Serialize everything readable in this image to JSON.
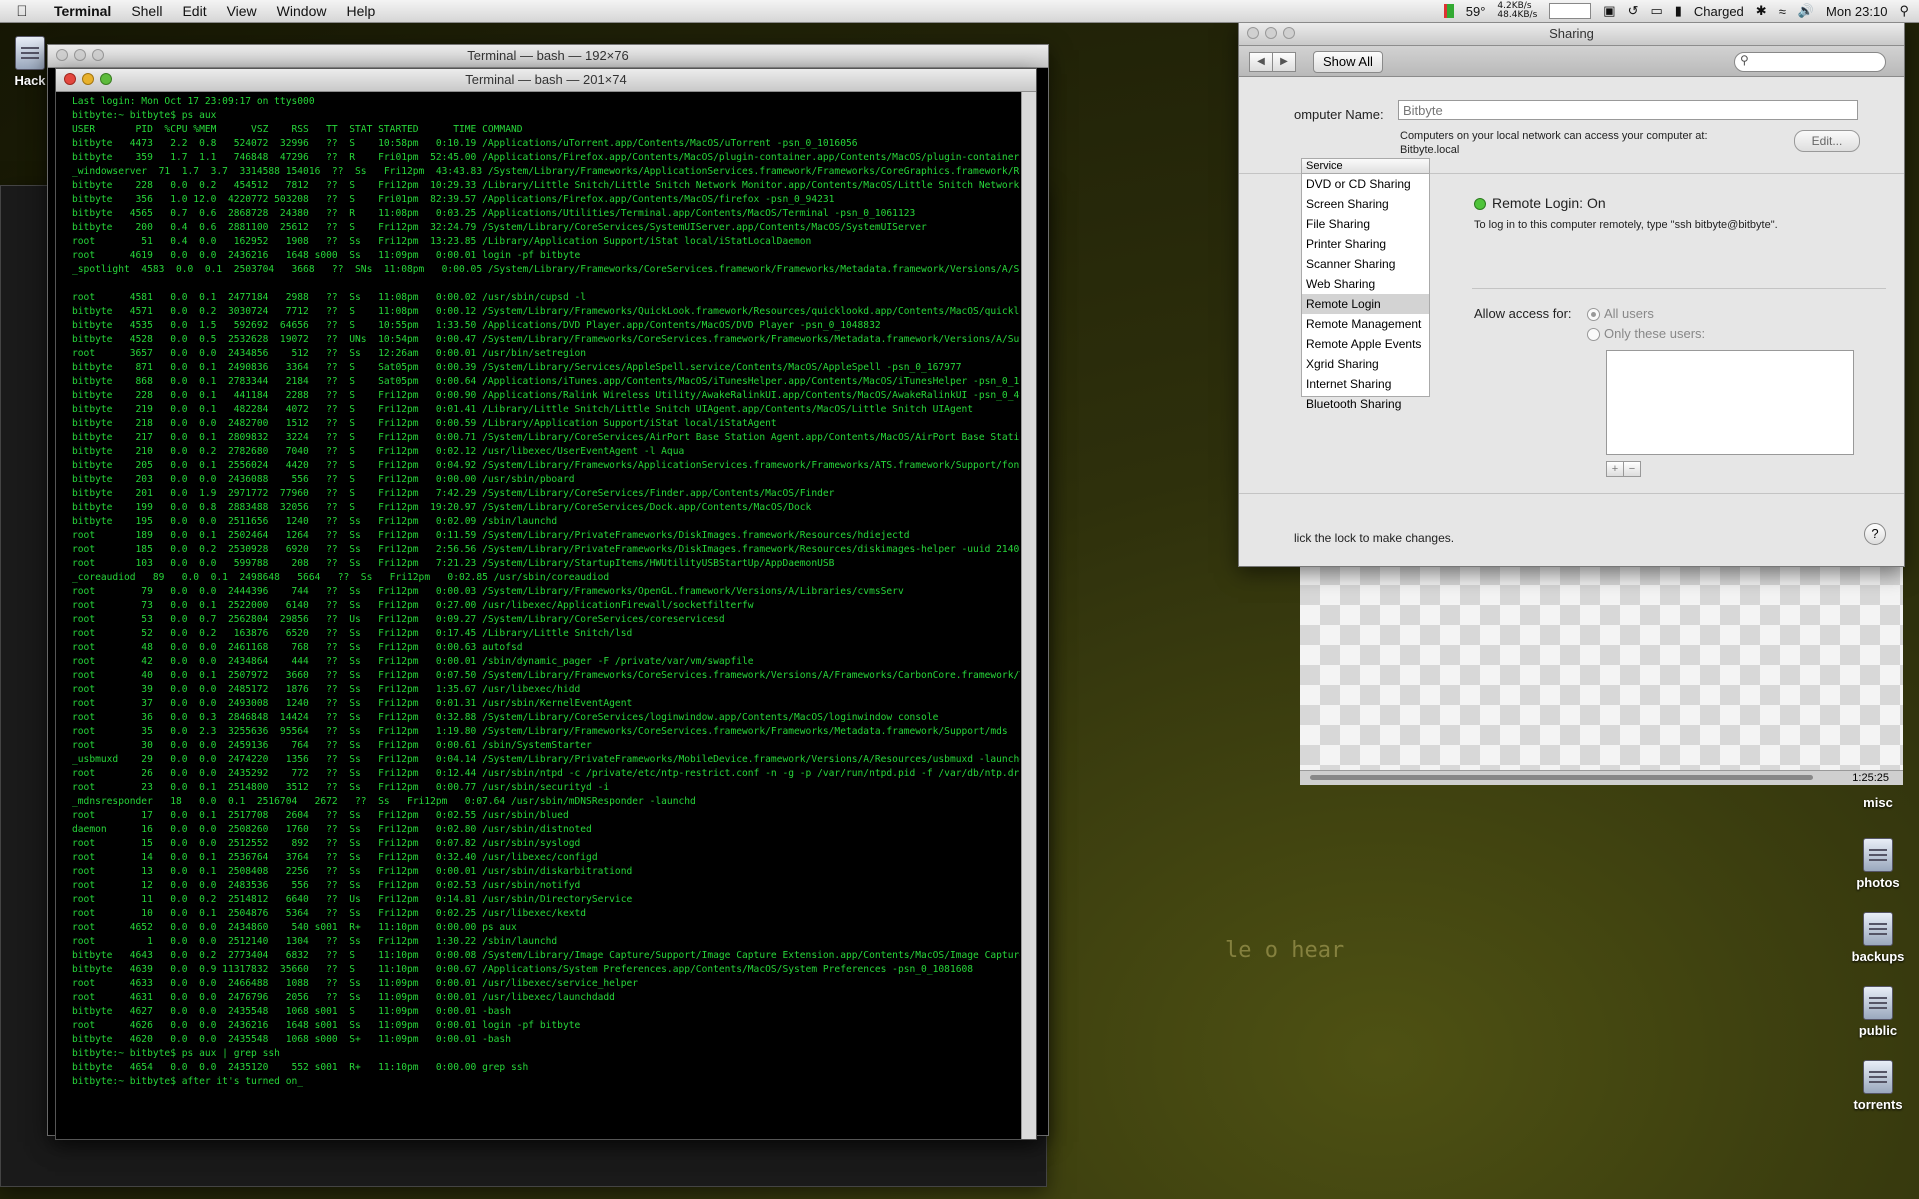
{
  "menubar": {
    "app_name": "Terminal",
    "menus": [
      "Shell",
      "Edit",
      "View",
      "Window",
      "Help"
    ],
    "status": {
      "temperature": "59°",
      "net_up": "4.2KB/s",
      "net_down": "48.4KB/s",
      "battery": "Charged",
      "clock": "Mon 23:10"
    }
  },
  "desktop": {
    "left_label": "Hack",
    "drives": [
      "misc",
      "photos",
      "backups",
      "public",
      "torrents"
    ],
    "wallpaper_text": "le  o hear"
  },
  "terminal_back": {
    "title": "Terminal — bash — 192×76"
  },
  "terminal_front": {
    "title": "Terminal — bash — 201×74",
    "lines": [
      "Last login: Mon Oct 17 23:09:17 on ttys000",
      "bitbyte:~ bitbyte$ ps aux",
      "USER       PID  %CPU %MEM      VSZ    RSS   TT  STAT STARTED      TIME COMMAND",
      "bitbyte   4473   2.2  0.8   524072  32996   ??  S    10:58pm   0:10.19 /Applications/uTorrent.app/Contents/MacOS/uTorrent -psn_0_1016056",
      "bitbyte    359   1.7  1.1   746848  47296   ??  R    Fri01pm  52:45.00 /Applications/Firefox.app/Contents/MacOS/plugin-container.app/Contents/MacOS/plugin-container /Library/Internet Plug-Ins/Flash Pl",
      "_windowserver  71  1.7  3.7  3314588 154016  ??  Ss   Fri12pm  43:43.83 /System/Library/Frameworks/ApplicationServices.framework/Frameworks/CoreGraphics.framework/Resources/WindowServer -daemon",
      "bitbyte    228   0.0  0.2   454512   7812   ??  S    Fri12pm  10:29.33 /Library/Little Snitch/Little Snitch Network Monitor.app/Contents/MacOS/Little Snitch Network Monitor",
      "bitbyte    356   1.0 12.0  4220772 503208   ??  S    Fri01pm  82:39.57 /Applications/Firefox.app/Contents/MacOS/firefox -psn_0_94231",
      "bitbyte   4565   0.7  0.6  2868728  24380   ??  R    11:08pm   0:03.25 /Applications/Utilities/Terminal.app/Contents/MacOS/Terminal -psn_0_1061123",
      "bitbyte    200   0.4  0.6  2881100  25612   ??  S    Fri12pm  32:24.79 /System/Library/CoreServices/SystemUIServer.app/Contents/MacOS/SystemUIServer",
      "root        51   0.4  0.0   162952   1908   ??  Ss   Fri12pm  13:23.85 /Library/Application Support/iStat local/iStatLocalDaemon",
      "root      4619   0.0  0.0  2436216   1648 s000  Ss   11:09pm   0:00.01 login -pf bitbyte",
      "_spotlight  4583  0.0  0.1  2503704   3668   ??  SNs  11:08pm   0:00.05 /System/Library/Frameworks/CoreServices.framework/Frameworks/Metadata.framework/Versions/A/Support/mdworker MDSImporterWorker co",
      "",
      "root      4581   0.0  0.1  2477184   2988   ??  Ss   11:08pm   0:00.02 /usr/sbin/cupsd -l",
      "bitbyte   4571   0.0  0.2  3030724   7712   ??  S    11:08pm   0:00.12 /System/Library/Frameworks/QuickLook.framework/Resources/quicklookd.app/Contents/MacOS/quicklookd",
      "bitbyte   4535   0.0  1.5   592692  64656   ??  S    10:55pm   1:33.50 /Applications/DVD Player.app/Contents/MacOS/DVD Player -psn_0_1048832",
      "bitbyte   4528   0.0  0.5  2532628  19072   ??  UNs  10:54pm   0:00.47 /System/Library/Frameworks/CoreServices.framework/Frameworks/Metadata.framework/Versions/A/Support/mdworker MDSImporterWorker com",
      "root      3657   0.0  0.0  2434856    512   ??  Ss   12:26am   0:00.01 /usr/bin/setregion",
      "bitbyte    871   0.0  0.1  2490836   3364   ??  S    Sat05pm   0:00.39 /System/Library/Services/AppleSpell.service/Contents/MacOS/AppleSpell -psn_0_167977",
      "bitbyte    868   0.0  0.1  2783344   2184   ??  S    Sat05pm   0:00.64 /Applications/iTunes.app/Contents/MacOS/iTunesHelper.app/Contents/MacOS/iTunesHelper -psn_0_163880",
      "bitbyte    228   0.0  0.1   441184   2288   ??  S    Fri12pm   0:00.90 /Applications/Ralink Wireless Utility/AwakeRalinkUI.app/Contents/MacOS/AwakeRalinkUI -psn_0_49164",
      "bitbyte    219   0.0  0.1   482284   4072   ??  S    Fri12pm   0:01.41 /Library/Little Snitch/Little Snitch UIAgent.app/Contents/MacOS/Little Snitch UIAgent",
      "bitbyte    218   0.0  0.0  2482700   1512   ??  S    Fri12pm   0:00.59 /Library/Application Support/iStat local/iStatAgent",
      "bitbyte    217   0.0  0.1  2809832   3224   ??  S    Fri12pm   0:00.71 /System/Library/CoreServices/AirPort Base Station Agent.app/Contents/MacOS/AirPort Base Station Agent -launchd -allowquit",
      "bitbyte    210   0.0  0.2  2782680   7040   ??  S    Fri12pm   0:02.12 /usr/libexec/UserEventAgent -l Aqua",
      "bitbyte    205   0.0  0.1  2556024   4420   ??  S    Fri12pm   0:04.92 /System/Library/Frameworks/ApplicationServices.framework/Frameworks/ATS.framework/Support/fontd",
      "bitbyte    203   0.0  0.0  2436088    556   ??  S    Fri12pm   0:00.00 /usr/sbin/pboard",
      "bitbyte    201   0.0  1.9  2971772  77960   ??  S    Fri12pm   7:42.29 /System/Library/CoreServices/Finder.app/Contents/MacOS/Finder",
      "bitbyte    199   0.0  0.8  2883488  32056   ??  S    Fri12pm  19:20.97 /System/Library/CoreServices/Dock.app/Contents/MacOS/Dock",
      "bitbyte    195   0.0  0.0  2511656   1240   ??  Ss   Fri12pm   0:02.09 /sbin/launchd",
      "root       189   0.0  0.1  2502464   1264   ??  Ss   Fri12pm   0:11.59 /System/Library/PrivateFrameworks/DiskImages.framework/Resources/hdiejectd",
      "root       185   0.0  0.2  2530928   6920   ??  Ss   Fri12pm   2:56.56 /System/Library/PrivateFrameworks/DiskImages.framework/Resources/diskimages-helper -uuid 2140818F-C632-4D85-A243-3D146F4D1E2F -po",
      "root       103   0.0  0.0   599788    208   ??  Ss   Fri12pm   7:21.23 /System/Library/StartupItems/HWUtilityUSBStartUp/AppDaemonUSB",
      "_coreaudiod   89   0.0  0.1  2498648   5664   ??  Ss   Fri12pm   0:02.85 /usr/sbin/coreaudiod",
      "root        79   0.0  0.0  2444396    744   ??  Ss   Fri12pm   0:00.03 /System/Library/Frameworks/OpenGL.framework/Versions/A/Libraries/cvmsServ",
      "root        73   0.0  0.1  2522000   6140   ??  Ss   Fri12pm   0:27.00 /usr/libexec/ApplicationFirewall/socketfilterfw",
      "root        53   0.0  0.7  2562804  29856   ??  Us   Fri12pm   0:09.27 /System/Library/CoreServices/coreservicesd",
      "root        52   0.0  0.2   163876   6520   ??  Ss   Fri12pm   0:17.45 /Library/Little Snitch/lsd",
      "root        48   0.0  0.0  2461168    768   ??  Ss   Fri12pm   0:00.63 autofsd",
      "root        42   0.0  0.0  2434864    444   ??  Ss   Fri12pm   0:00.01 /sbin/dynamic_pager -F /private/var/vm/swapfile",
      "root        40   0.0  0.1  2507972   3660   ??  Ss   Fri12pm   0:07.50 /System/Library/Frameworks/CoreServices.framework/Versions/A/Frameworks/CarbonCore.framework/Versions/A/Support/fseventsd",
      "root        39   0.0  0.0  2485172   1876   ??  Ss   Fri12pm   1:35.67 /usr/libexec/hidd",
      "root        37   0.0  0.0  2493008   1240   ??  Ss   Fri12pm   0:01.31 /usr/sbin/KernelEventAgent",
      "root        36   0.0  0.3  2846848  14424   ??  Ss   Fri12pm   0:32.88 /System/Library/CoreServices/loginwindow.app/Contents/MacOS/loginwindow console",
      "root        35   0.0  2.3  3255636  95564   ??  Ss   Fri12pm   1:19.80 /System/Library/Frameworks/CoreServices.framework/Frameworks/Metadata.framework/Support/mds",
      "root        30   0.0  0.0  2459136    764   ??  Ss   Fri12pm   0:00.61 /sbin/SystemStarter",
      "_usbmuxd    29   0.0  0.0  2474220   1356   ??  Ss   Fri12pm   0:04.14 /System/Library/PrivateFrameworks/MobileDevice.framework/Versions/A/Resources/usbmuxd -launchd",
      "root        26   0.0  0.0  2435292    772   ??  Ss   Fri12pm   0:12.44 /usr/sbin/ntpd -c /private/etc/ntp-restrict.conf -n -g -p /var/run/ntpd.pid -f /var/db/ntp.drift",
      "root        23   0.0  0.1  2514800   3512   ??  Ss   Fri12pm   0:00.77 /usr/sbin/securityd -i",
      "_mdnsresponder   18   0.0  0.1  2516704   2672   ??  Ss   Fri12pm   0:07.64 /usr/sbin/mDNSResponder -launchd",
      "root        17   0.0  0.1  2517708   2604   ??  Ss   Fri12pm   0:02.55 /usr/sbin/blued",
      "daemon      16   0.0  0.0  2508260   1760   ??  Ss   Fri12pm   0:02.80 /usr/sbin/distnoted",
      "root        15   0.0  0.0  2512552    892   ??  Ss   Fri12pm   0:07.82 /usr/sbin/syslogd",
      "root        14   0.0  0.1  2536764   3764   ??  Ss   Fri12pm   0:32.40 /usr/libexec/configd",
      "root        13   0.0  0.1  2508408   2256   ??  Ss   Fri12pm   0:00.01 /usr/sbin/diskarbitrationd",
      "root        12   0.0  0.0  2483536    556   ??  Ss   Fri12pm   0:02.53 /usr/sbin/notifyd",
      "root        11   0.0  0.2  2514812   6640   ??  Us   Fri12pm   0:14.81 /usr/sbin/DirectoryService",
      "root        10   0.0  0.1  2504876   5364   ??  Ss   Fri12pm   0:02.25 /usr/libexec/kextd",
      "root      4652   0.0  0.0  2434860    540 s001  R+   11:10pm   0:00.00 ps aux",
      "root         1   0.0  0.0  2512140   1304   ??  Ss   Fri12pm   1:30.22 /sbin/launchd",
      "bitbyte   4643   0.0  0.2  2773404   6832   ??  S    11:10pm   0:00.08 /System/Library/Image Capture/Support/Image Capture Extension.app/Contents/MacOS/Image Capture Extension -psn_0_1085705",
      "bitbyte   4639   0.0  0.9 11317832  35660   ??  S    11:10pm   0:00.67 /Applications/System Preferences.app/Contents/MacOS/System Preferences -psn_0_1081608",
      "root      4633   0.0  0.0  2466488   1088   ??  Ss   11:09pm   0:00.01 /usr/libexec/service_helper",
      "root      4631   0.0  0.0  2476796   2056   ??  Ss   11:09pm   0:00.01 /usr/libexec/launchdadd",
      "bitbyte   4627   0.0  0.0  2435548   1068 s001  S    11:09pm   0:00.01 -bash",
      "root      4626   0.0  0.0  2436216   1648 s001  Ss   11:09pm   0:00.01 login -pf bitbyte",
      "bitbyte   4620   0.0  0.0  2435548   1068 s000  S+   11:09pm   0:00.01 -bash",
      "bitbyte:~ bitbyte$ ps aux | grep ssh",
      "bitbyte   4654   0.0  0.0  2435120    552 s001  R+   11:10pm   0:00.00 grep ssh",
      "bitbyte:~ bitbyte$ after it's turned on_"
    ]
  },
  "sharing": {
    "title": "Sharing",
    "show_all": "Show All",
    "computer_name_label": "omputer Name:",
    "computer_name_value": "Bitbyte",
    "computer_name_desc_1": "Computers on your local network can access your computer at:",
    "computer_name_desc_2": "Bitbyte.local",
    "edit_button": "Edit...",
    "service_header": "Service",
    "services": [
      "DVD or CD Sharing",
      "Screen Sharing",
      "File Sharing",
      "Printer Sharing",
      "Scanner Sharing",
      "Web Sharing",
      "Remote Login",
      "Remote Management",
      "Remote Apple Events",
      "Xgrid Sharing",
      "Internet Sharing",
      "Bluetooth Sharing"
    ],
    "status_title": "Remote Login: On",
    "status_desc": "To log in to this computer remotely, type \"ssh bitbyte@bitbyte\".",
    "allow_access_label": "Allow access for:",
    "option_all": "All users",
    "option_only": "Only these users:",
    "lock_text": "lick the lock to make changes.",
    "help": "?"
  },
  "media": {
    "time": "1:25:25"
  }
}
